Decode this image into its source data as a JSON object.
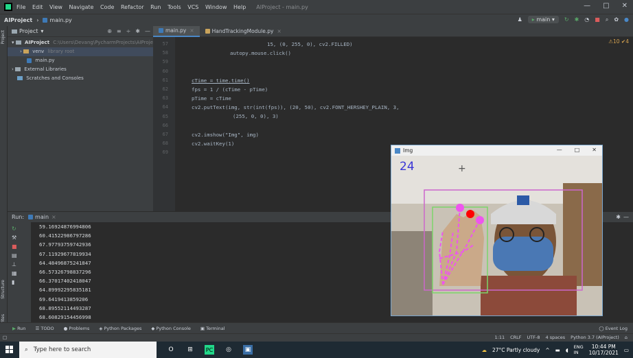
{
  "titlebar": {
    "menu": [
      "File",
      "Edit",
      "View",
      "Navigate",
      "Code",
      "Refactor",
      "Run",
      "Tools",
      "VCS",
      "Window",
      "Help"
    ],
    "window_title": "AIProject - main.py",
    "controls": [
      "—",
      "□",
      "✕"
    ]
  },
  "navbar": {
    "project": "AIProject",
    "file": "main.py",
    "run_config": "main"
  },
  "project_panel": {
    "title": "Project",
    "root_name": "AIProject",
    "root_path": "C:\\Users\\Devang\\PycharmProjects\\AIProject",
    "venv_name": "venv",
    "venv_note": "library root",
    "main_file": "main.py",
    "external": "External Libraries",
    "scratches": "Scratches and Consoles"
  },
  "tabs": [
    {
      "label": "main.py"
    },
    {
      "label": "HandTrackingModule.py"
    }
  ],
  "editor": {
    "line_numbers": [
      "57",
      "58",
      "59",
      "60",
      "61",
      "62",
      "63",
      "64",
      "65",
      "66",
      "67",
      "68",
      "69"
    ],
    "lines": {
      "l56": "15, (0, 255, 0), cv2.FILLED)",
      "l57": "autopy.mouse.click()",
      "l61": "cTime = time.time()",
      "l62": "fps = 1 / (cTime - pTime)",
      "l63": "pTime = cTime",
      "l64": "cv2.putText(img, str(int(fps)), (20, 50), cv2.FONT_HERSHEY_PLAIN, 3,",
      "l65": "(255, 0, 0), 3)",
      "l67": "cv2.imshow(\"Img\", img)",
      "l68": "cv2.waitKey(1)"
    },
    "warnings": "⚠10  ✔4"
  },
  "run_panel": {
    "label": "Run:",
    "config": "main",
    "output": [
      "59.16924876994806",
      "60.41522986797286",
      "67.97793759742936",
      "67.11929677819934",
      "64.48496875241847",
      "66.57326798837296",
      "66.37017402418047",
      "64.89992295835181",
      "69.6419413859206",
      "68.89552114493287",
      "68.60829154456998"
    ]
  },
  "tool_windows": [
    "Run",
    "TODO",
    "Problems",
    "Python Packages",
    "Python Console",
    "Terminal"
  ],
  "event_log": "Event Log",
  "statusbar": {
    "position": "1:11",
    "line_sep": "CRLF",
    "encoding": "UTF-8",
    "indent": "4 spaces",
    "interpreter": "Python 3.7 (AIProject)"
  },
  "camera_window": {
    "title": "Img",
    "fps_text": "24"
  },
  "taskbar": {
    "search_placeholder": "Type here to search",
    "weather": "27°C  Partly cloudy",
    "lang_top": "ENG",
    "lang_bottom": "IN",
    "time": "10:44 PM",
    "date": "10/17/2021"
  },
  "colors": {
    "accent": "#4a88c7",
    "fps_text": "#3a35d6",
    "landmark": "#ee55ee",
    "bbox": "#cc66cc",
    "click_dot": "#ff0000",
    "hand_box": "#7cd46a"
  }
}
